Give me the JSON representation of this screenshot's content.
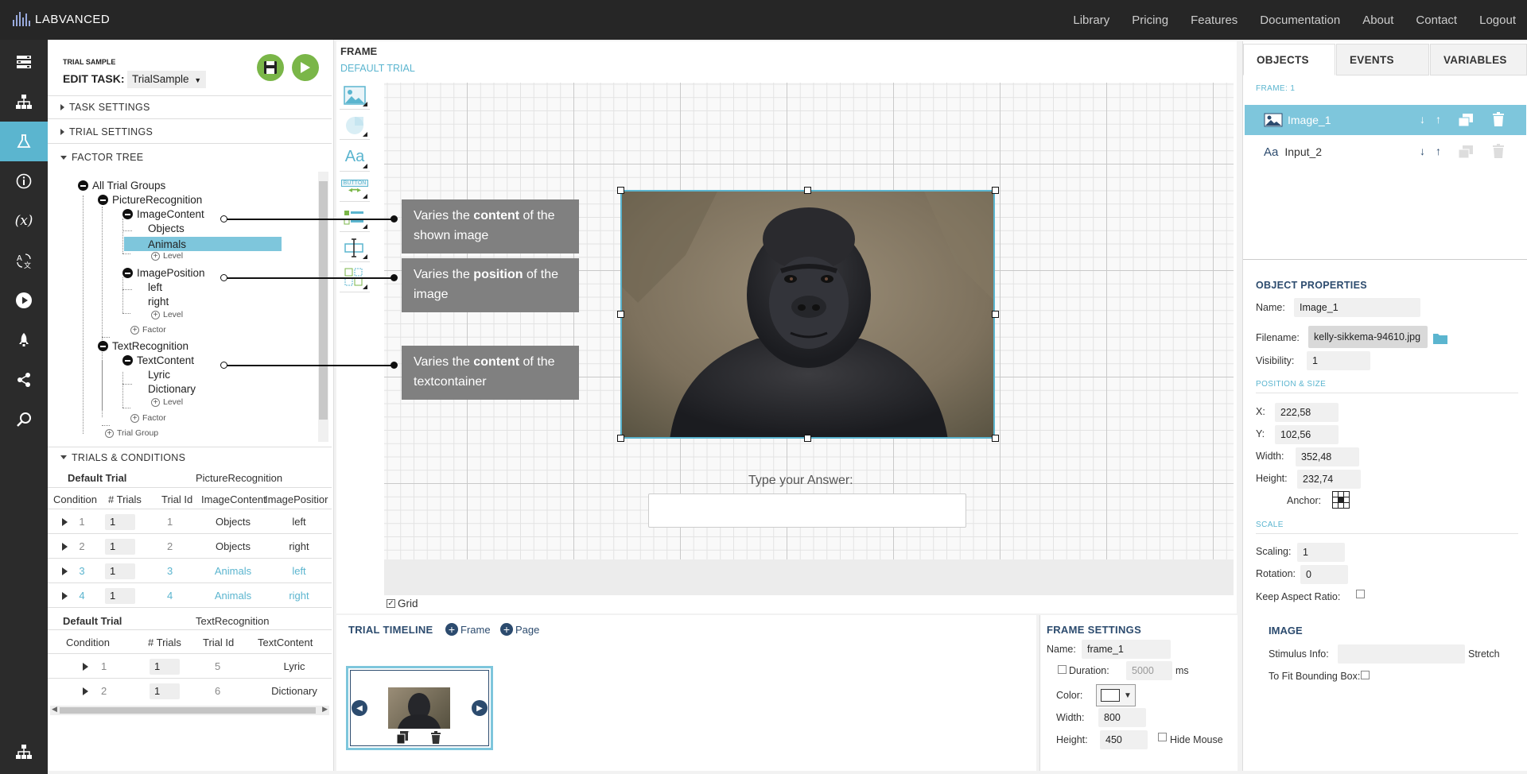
{
  "header": {
    "logo": "LABVANCED",
    "nav": [
      "Library",
      "Pricing",
      "Features",
      "Documentation",
      "About",
      "Contact",
      "Logout"
    ]
  },
  "left_panel": {
    "breadcrumb": "TRIAL SAMPLE",
    "edit_task_label": "EDIT TASK:",
    "task_select": "TrialSample",
    "sections": {
      "task_settings": "TASK SETTINGS",
      "trial_settings": "TRIAL SETTINGS",
      "factor_tree": "FACTOR TREE",
      "trials_conditions": "TRIALS & CONDITIONS"
    },
    "tree": {
      "root": "All Trial Groups",
      "group1": "PictureRecognition",
      "f1": "ImageContent",
      "f1_l1": "Objects",
      "f1_l2": "Animals",
      "f1_add": "Level",
      "f2": "ImagePosition",
      "f2_l1": "left",
      "f2_l2": "right",
      "f2_add": "Level",
      "g1_add_factor": "Factor",
      "group2": "TextRecognition",
      "f3": "TextContent",
      "f3_l1": "Lyric",
      "f3_l2": "Dictionary",
      "f3_add": "Level",
      "g2_add_factor": "Factor",
      "add_group": "Trial Group"
    },
    "table1": {
      "trial": "Default Trial",
      "group": "PictureRecognition",
      "headers": [
        "Condition",
        "# Trials",
        "Trial Id",
        "ImageContent",
        "ImagePositior"
      ],
      "rows": [
        {
          "cond": "1",
          "n": "1",
          "id": "1",
          "content": "Objects",
          "pos": "left"
        },
        {
          "cond": "2",
          "n": "1",
          "id": "2",
          "content": "Objects",
          "pos": "right"
        },
        {
          "cond": "3",
          "n": "1",
          "id": "3",
          "content": "Animals",
          "pos": "left"
        },
        {
          "cond": "4",
          "n": "1",
          "id": "4",
          "content": "Animals",
          "pos": "right"
        }
      ]
    },
    "table2": {
      "trial": "Default Trial",
      "group": "TextRecognition",
      "headers": [
        "Condition",
        "# Trials",
        "Trial Id",
        "TextContent"
      ],
      "rows": [
        {
          "cond": "1",
          "n": "1",
          "id": "5",
          "content": "Lyric"
        },
        {
          "cond": "2",
          "n": "1",
          "id": "6",
          "content": "Dictionary"
        }
      ]
    }
  },
  "center": {
    "title": "FRAME",
    "subtitle": "DEFAULT TRIAL",
    "tool_button_label": "BUTTON",
    "tooltips": [
      {
        "pre": "Varies the ",
        "bold": "content",
        "post": " of the shown image"
      },
      {
        "pre": "Varies the ",
        "bold": "position",
        "post": " of the image"
      },
      {
        "pre": "Varies the ",
        "bold": "content",
        "post": " of the textcontainer"
      }
    ],
    "answer_label": "Type your Answer:",
    "grid_label": "Grid"
  },
  "right_panel": {
    "tabs": [
      "OBJECTS",
      "EVENTS",
      "VARIABLES"
    ],
    "frame_label": "FRAME: 1",
    "objects": [
      {
        "name": "Image_1"
      },
      {
        "name": "Input_2"
      }
    ],
    "props_title": "OBJECT PROPERTIES",
    "name_label": "Name:",
    "name_value": "Image_1",
    "filename_label": "Filename:",
    "filename_value": "kelly-sikkema-94610.jpg",
    "visibility_label": "Visibility:",
    "visibility_value": "1",
    "pos_size_title": "POSITION & SIZE",
    "x_label": "X:",
    "x_value": "222,58",
    "y_label": "Y:",
    "y_value": "102,56",
    "width_label": "Width:",
    "width_value": "352,48",
    "height_label": "Height:",
    "height_value": "232,74",
    "anchor_label": "Anchor:",
    "scale_title": "SCALE",
    "scaling_label": "Scaling:",
    "scaling_value": "1",
    "rotation_label": "Rotation:",
    "rotation_value": "0",
    "keep_aspect_label": "Keep Aspect Ratio:",
    "image_title": "IMAGE",
    "stimulus_label": "Stimulus Info:",
    "stretch_label": "Stretch",
    "fit_label": "To Fit Bounding Box:"
  },
  "timeline": {
    "title": "TRIAL TIMELINE",
    "add_frame": "Frame",
    "add_page": "Page"
  },
  "frame_settings": {
    "title": "FRAME SETTINGS",
    "name_label": "Name:",
    "name_value": "frame_1",
    "duration_label": "Duration:",
    "duration_value": "5000",
    "duration_unit": "ms",
    "color_label": "Color:",
    "width_label": "Width:",
    "width_value": "800",
    "height_label": "Height:",
    "height_value": "450",
    "hide_mouse_label": "Hide Mouse"
  },
  "colors": {
    "accent": "#5bb5cf",
    "topbar": "#262626",
    "rail": "#2b2b2b",
    "green": "#7ab648"
  }
}
